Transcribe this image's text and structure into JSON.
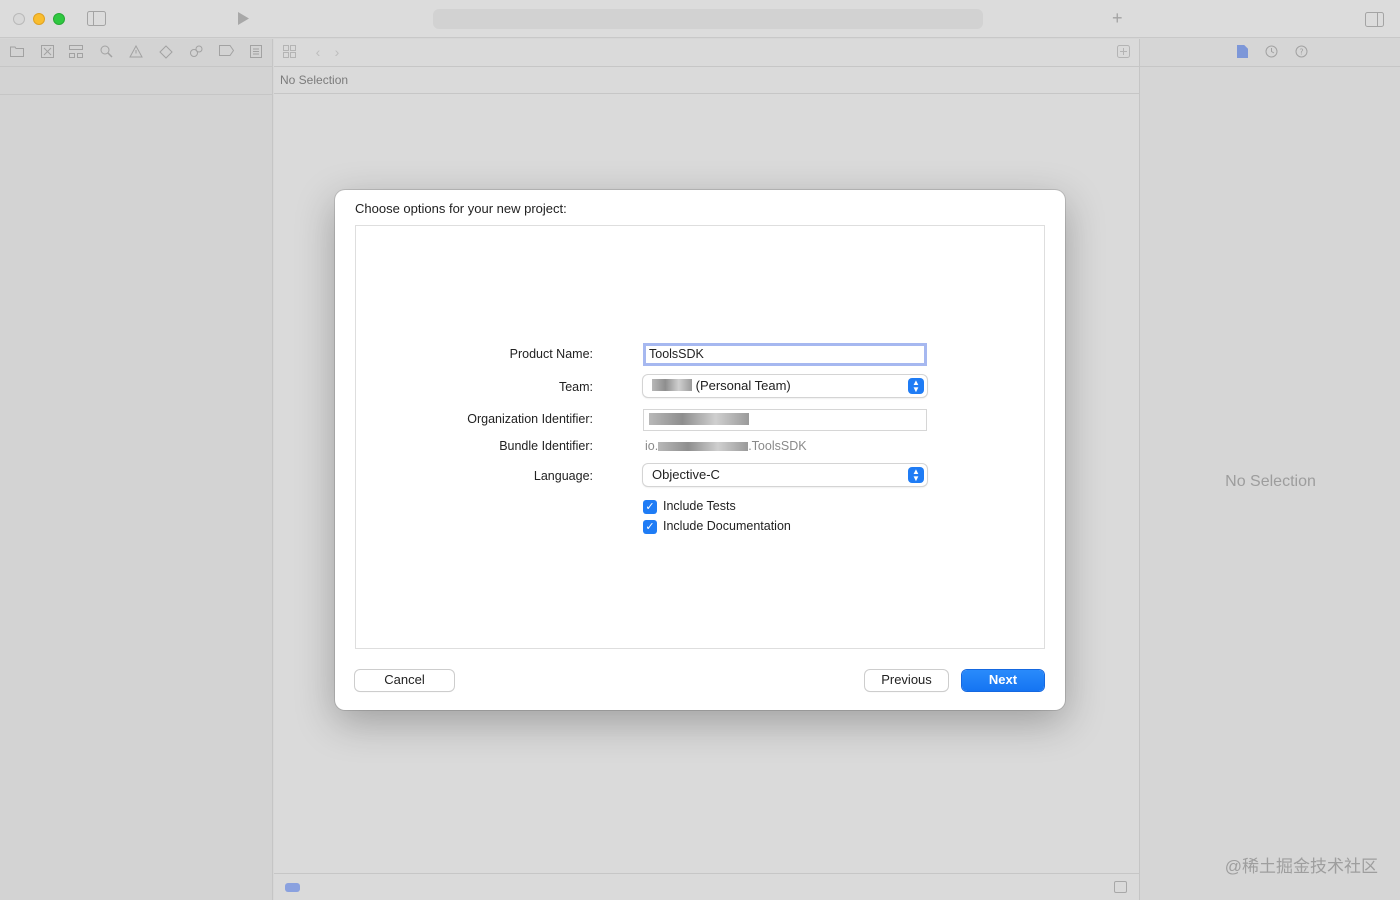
{
  "window": {
    "jump_bar_text": "No Selection",
    "inspector_empty_text": "No Selection",
    "watermark": "@稀土掘金技术社区"
  },
  "dialog": {
    "title": "Choose options for your new project:",
    "fields": {
      "product_name_label": "Product Name:",
      "product_name_value": "ToolsSDK",
      "team_label": "Team:",
      "team_value": "(Personal Team)",
      "org_identifier_label": "Organization Identifier:",
      "bundle_identifier_label": "Bundle Identifier:",
      "bundle_identifier_prefix": "io.",
      "bundle_identifier_suffix": ".ToolsSDK",
      "language_label": "Language:",
      "language_value": "Objective-C"
    },
    "checkboxes": {
      "include_tests_label": "Include Tests",
      "include_tests_checked": true,
      "include_documentation_label": "Include Documentation",
      "include_documentation_checked": true
    },
    "buttons": {
      "cancel": "Cancel",
      "previous": "Previous",
      "next": "Next"
    }
  },
  "colors": {
    "accent": "#1f7cf5",
    "focus_ring": "#a6b8f0"
  },
  "icons": {
    "toolbar": [
      "sidebar-toggle-icon",
      "run-icon",
      "add-icon",
      "inspector-toggle-icon"
    ],
    "navigator": [
      "folder-icon",
      "source-control-icon",
      "symbol-icon",
      "find-icon",
      "issue-icon",
      "test-icon",
      "debug-icon",
      "breakpoint-icon",
      "report-icon"
    ],
    "inspector": [
      "file-inspector-icon",
      "history-icon",
      "help-icon"
    ]
  }
}
